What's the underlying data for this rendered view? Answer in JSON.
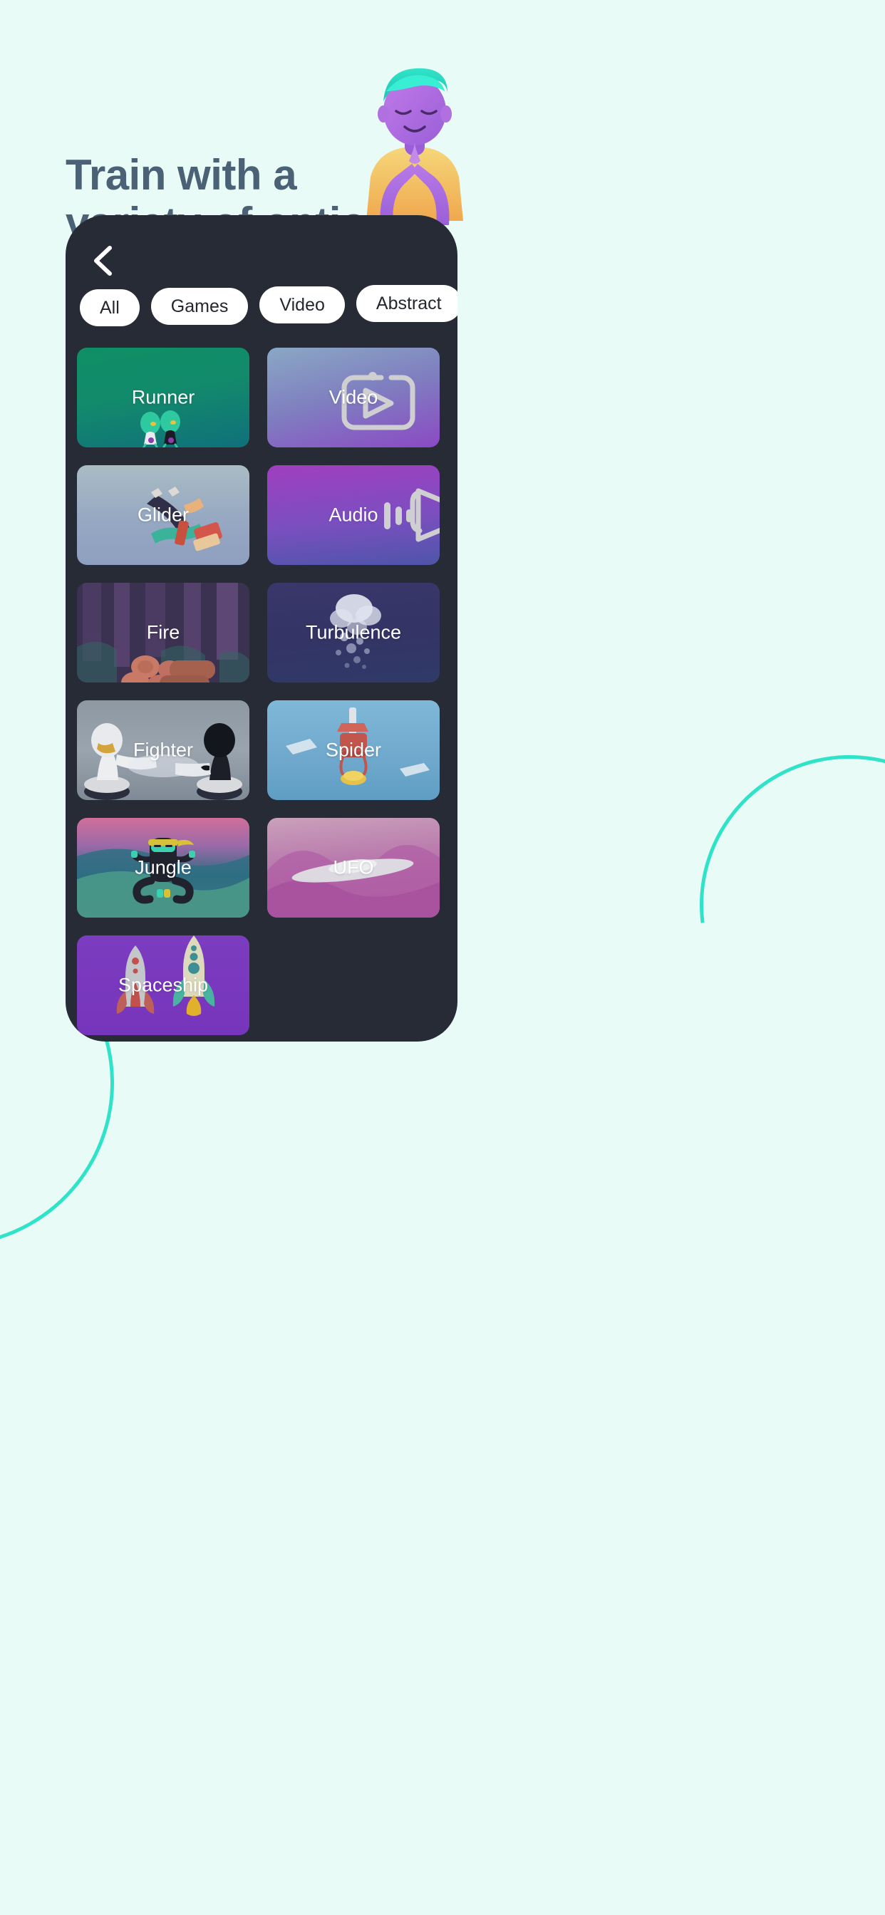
{
  "page": {
    "background_color": "#e8fbf7",
    "accent_color": "#2fe3c8",
    "headline_color": "#4b6276"
  },
  "headline": {
    "line1": "Train with a",
    "line2": "variety of options"
  },
  "hero": {
    "character_name": "meditating-avatar"
  },
  "phone": {
    "frame_color": "#272b35",
    "back_button_icon": "chevron-left-icon"
  },
  "filters": {
    "items": [
      {
        "label": "All",
        "selected": true
      },
      {
        "label": "Games",
        "selected": false
      },
      {
        "label": "Video",
        "selected": false
      },
      {
        "label": "Abstract",
        "selected": false
      }
    ]
  },
  "cards": [
    {
      "label": "Runner",
      "art": "alien-runners-icon",
      "theme": "runner"
    },
    {
      "label": "Video",
      "art": "video-play-icon",
      "theme": "video"
    },
    {
      "label": "Glider",
      "art": "skydiver-icon",
      "theme": "glider"
    },
    {
      "label": "Audio",
      "art": "speaker-waves-icon",
      "theme": "audio"
    },
    {
      "label": "Fire",
      "art": "campfire-logs-icon",
      "theme": "fire"
    },
    {
      "label": "Turbulence",
      "art": "smoke-cloud-icon",
      "theme": "turbulence"
    },
    {
      "label": "Fighter",
      "art": "chess-fighters-icon",
      "theme": "fighter"
    },
    {
      "label": "Spider",
      "art": "spider-tower-icon",
      "theme": "spider"
    },
    {
      "label": "Jungle",
      "art": "ninja-meditate-icon",
      "theme": "jungle"
    },
    {
      "label": "UFO",
      "art": "ufo-hills-icon",
      "theme": "ufo"
    },
    {
      "label": "Spaceship",
      "art": "rockets-icon",
      "theme": "spaceship"
    }
  ]
}
